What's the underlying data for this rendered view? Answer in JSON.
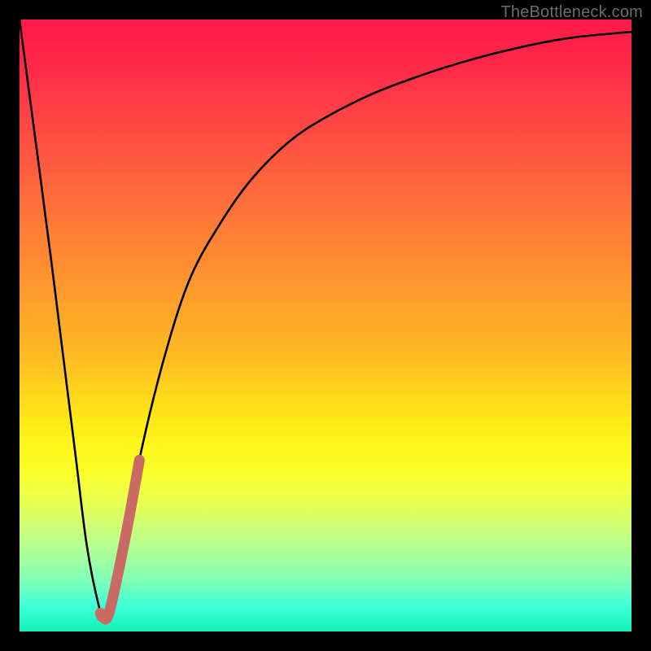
{
  "watermark": "TheBottleneck.com",
  "colors": {
    "curve": "#000000",
    "highlight": "#c96a65",
    "frame": "#000000"
  },
  "chart_data": {
    "type": "line",
    "title": "",
    "xlabel": "",
    "ylabel": "",
    "xlim": [
      0,
      100
    ],
    "ylim": [
      0,
      100
    ],
    "grid": false,
    "legend": false,
    "series": [
      {
        "name": "bottleneck-curve",
        "color": "#000000",
        "x": [
          0,
          5,
          9,
          11,
          13,
          14,
          15,
          17,
          20,
          24,
          28,
          33,
          38,
          44,
          50,
          58,
          66,
          74,
          82,
          90,
          100
        ],
        "y": [
          100,
          62,
          30,
          14,
          4,
          2,
          4,
          14,
          30,
          46,
          58,
          67,
          74,
          80,
          84,
          88,
          91,
          93.5,
          95.5,
          97,
          98
        ]
      },
      {
        "name": "highlight-segment",
        "color": "#c96a65",
        "x": [
          13.2,
          13.6,
          14.5,
          16.0,
          17.8,
          19.6
        ],
        "y": [
          3.0,
          2.3,
          2.6,
          9.0,
          18.0,
          28.0
        ]
      }
    ]
  }
}
